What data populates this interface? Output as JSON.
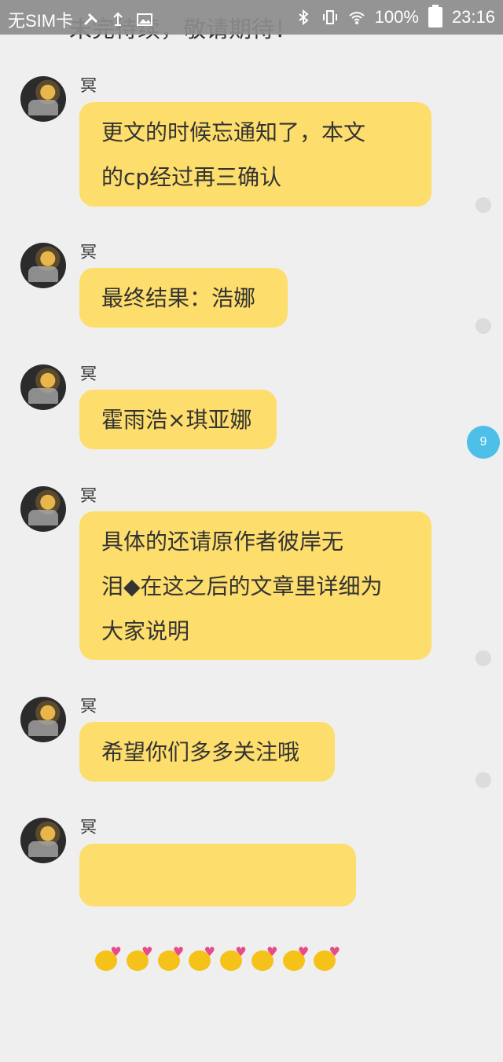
{
  "status_bar": {
    "sim": "无SIM卡",
    "battery_pct": "100%",
    "time": "23:16"
  },
  "partial_top_text": "未完待续，敬请期待！",
  "messages": [
    {
      "sender": "冥",
      "text": "更文的时候忘通知了，本文\n的cp经过再三确认"
    },
    {
      "sender": "冥",
      "text": "最终结果：浩娜"
    },
    {
      "sender": "冥",
      "text": "霍雨浩×琪亚娜"
    },
    {
      "sender": "冥",
      "text": "具体的还请原作者彼岸无\n泪◆在这之后的文章里详细为\n大家说明"
    },
    {
      "sender": "冥",
      "text": "希望你们多多关注哦"
    },
    {
      "sender": "冥",
      "emoji": "kiss-face-emoji",
      "emoji_count": 8
    }
  ],
  "unread_badge": "9",
  "colors": {
    "bubble": "#fddd6b",
    "badge": "#4dbfe8",
    "background": "#efefef"
  }
}
